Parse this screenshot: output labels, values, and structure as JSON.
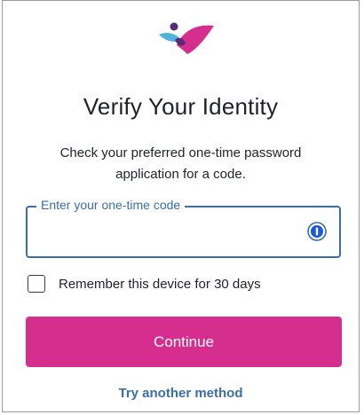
{
  "brand": {
    "logo_icon": "brand-logo-icon",
    "colors": {
      "pink": "#d62e8f",
      "purple": "#5a2a7a",
      "blue": "#4fb3dc"
    }
  },
  "header": {
    "title": "Verify Your Identity",
    "subtitle": "Check your preferred one-time password application for a code."
  },
  "otp_field": {
    "label": "Enter your one-time code",
    "value": "",
    "placeholder": "",
    "icon": "password-manager-icon",
    "border_color": "#3a6ea5"
  },
  "remember_device": {
    "label": "Remember this device for 30 days",
    "checked": false
  },
  "actions": {
    "continue_label": "Continue",
    "continue_color": "#d62e8f",
    "alt_method_label": "Try another method",
    "link_color": "#3a6ea5"
  }
}
